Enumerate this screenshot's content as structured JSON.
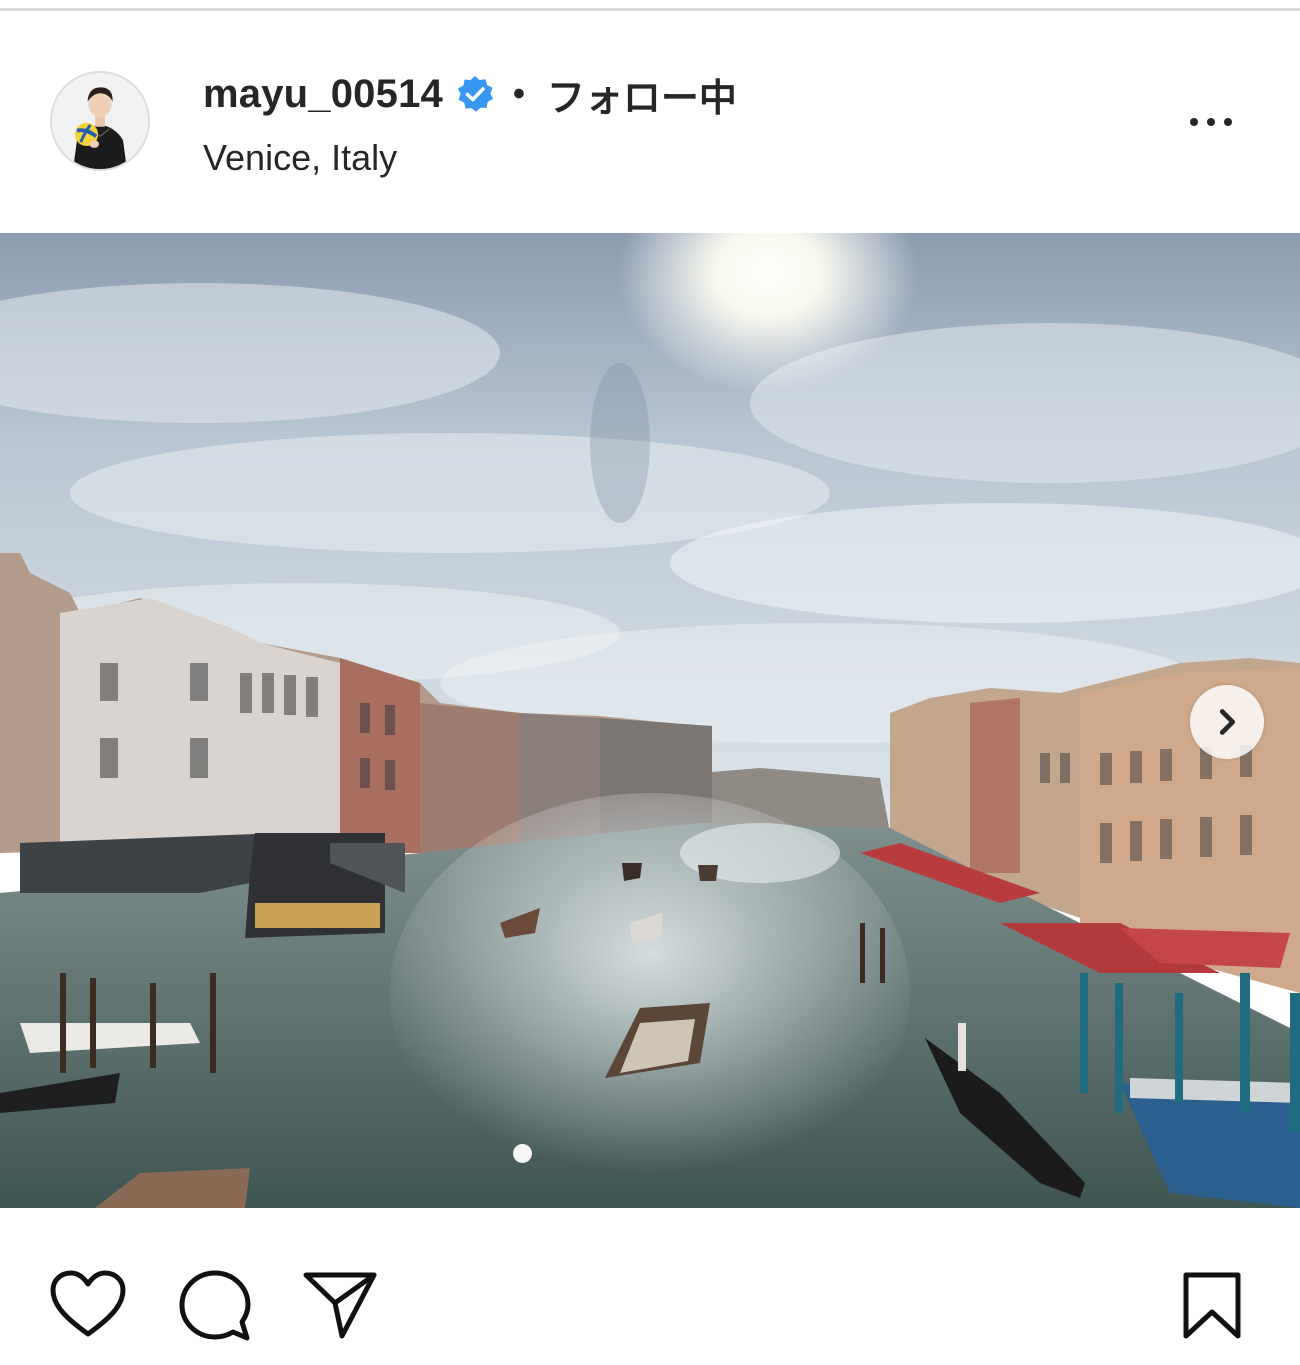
{
  "post": {
    "username": "mayu_00514",
    "verified": true,
    "separator": "•",
    "follow_status": "フォロー中",
    "location": "Venice, Italy"
  },
  "icons": {
    "verified": "verified-badge-icon",
    "more": "more-options-icon",
    "next": "chevron-right-icon",
    "like": "heart-icon",
    "comment": "comment-bubble-icon",
    "share": "paper-plane-icon",
    "save": "bookmark-icon"
  },
  "carousel": {
    "current_slide": 1
  },
  "colors": {
    "verified_blue": "#3897f0",
    "text": "#262626",
    "divider": "#dbdbdb"
  }
}
